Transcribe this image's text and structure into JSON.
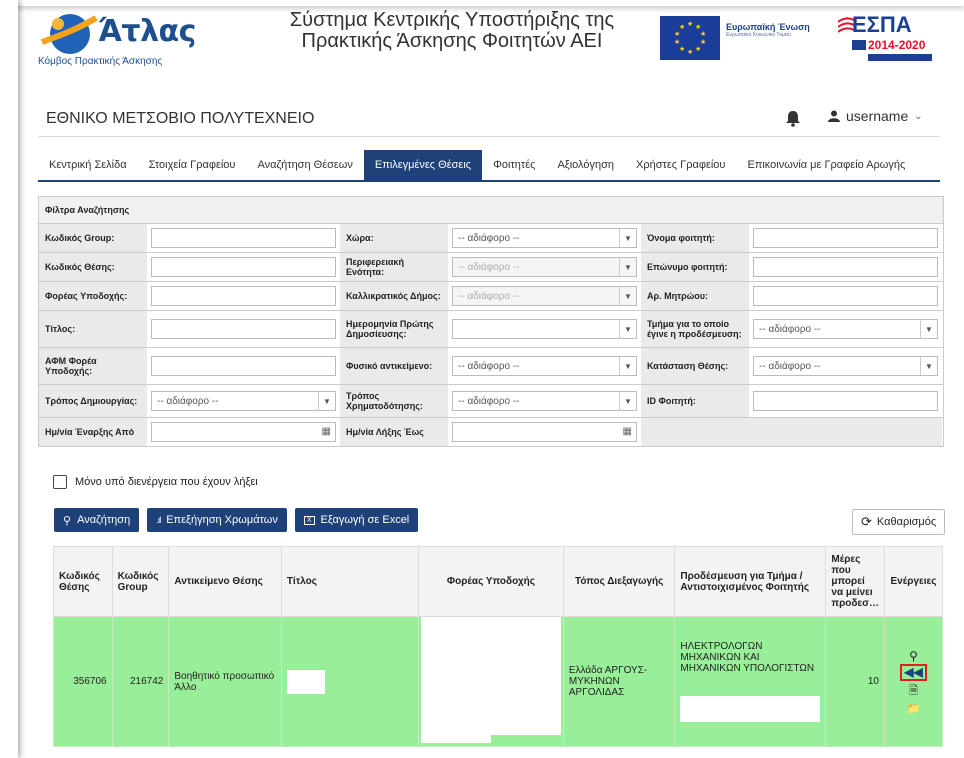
{
  "header": {
    "logo_text": "Άτλας",
    "logo_sub": "Κόμβος Πρακτικής Άσκησης",
    "title_line1": "Σύστημα Κεντρικής Υποστήριξης της",
    "title_line2": "Πρακτικής Άσκησης Φοιτητών ΑΕΙ",
    "eu_label": "Ευρωπαϊκή Ένωση",
    "eu_sub": "Ευρωπαϊκό Κοινωνικό Ταμείο",
    "espa_title": "ΕΣΠΑ",
    "espa_years": "2014-2020"
  },
  "institution": {
    "name": "ΕΘΝΙΚΟ ΜΕΤΣΟΒΙΟ ΠΟΛΥΤΕΧΝΕΙΟ",
    "username": "username"
  },
  "nav": [
    "Κεντρική Σελίδα",
    "Στοιχεία Γραφείου",
    "Αναζήτηση Θέσεων",
    "Επιλεγμένες Θέσεις",
    "Φοιτητές",
    "Αξιολόγηση",
    "Χρήστες Γραφείου",
    "Επικοινωνία με Γραφείο Αρωγής"
  ],
  "filters": {
    "title": "Φίλτρα Αναζήτησης",
    "any": "-- αδιάφορο --",
    "labels": {
      "group_code": "Κωδικός Group:",
      "country": "Χώρα:",
      "student_name": "Όνομα φοιτητή:",
      "position_code": "Κωδικός Θέσης:",
      "region": "Περιφερειακή Ενότητα:",
      "student_surname": "Επώνυμο φοιτητή:",
      "host": "Φορέας Υποδοχής:",
      "municipality": "Καλλικρατικός Δήμος:",
      "reg_no": "Αρ. Μητρώου:",
      "title": "Τίτλος:",
      "first_pub": "Ημερομηνία Πρώτης Δημοσίευσης:",
      "dept": "Τμήμα για το οποίο έγινε η προδέσμευση:",
      "afm": "ΑΦΜ Φορέα Υποδοχής:",
      "physical": "Φυσικό αντικείμενο:",
      "status": "Κατάσταση Θέσης:",
      "creation": "Τρόπος Δημιουργίας:",
      "funding": "Τρόπος Χρηματοδότησης:",
      "student_id": "ID Φοιτητή:",
      "start_from": "Ημ/νία Έναρξης Από",
      "end_to": "Ημ/νία Λήξης Έως"
    }
  },
  "only_expired": "Μόνο υπό διενέργεια που έχουν λήξει",
  "buttons": {
    "search": "Αναζήτηση",
    "colors": "Επεξήγηση Χρωμάτων",
    "excel": "Εξαγωγή σε Excel",
    "clear": "Καθαρισμός"
  },
  "table": {
    "headers": [
      "Κωδικός Θέσης",
      "Κωδικός Group",
      "Αντικείμενο Θέσης",
      "Τίτλος",
      "Φορέας Υποδοχής",
      "Τόπος Διεξαγωγής",
      "Προδέσμευση για Τμήμα / Αντιστοιχισμένος Φοιτητής",
      "Μέρες που μπορεί να μείνει προδεσ…",
      "Ενέργειες"
    ],
    "row": {
      "position_code": "356706",
      "group_code": "216742",
      "subject": "Βοηθητικό προσωπικό Άλλο",
      "place": "Ελλάδα ΑΡΓΟΥΣ-ΜΥΚΗΝΩΝ ΑΡΓΟΛΙΔΑΣ",
      "dept": "ΗΛΕΚΤΡΟΛΟΓΩΝ ΜΗΧΑΝΙΚΩΝ ΚΑΙ ΜΗΧΑΝΙΚΩΝ ΥΠΟΛΟΓΙΣΤΩΝ",
      "days": "10"
    }
  },
  "colors": {
    "primary": "#1d4178",
    "row_green": "#99ee99",
    "highlight": "#e02020"
  }
}
